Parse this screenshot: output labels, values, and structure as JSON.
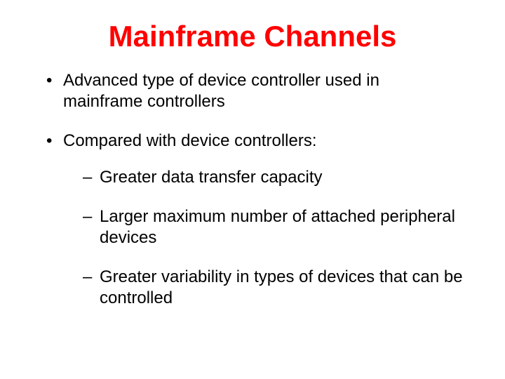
{
  "title": "Mainframe Channels",
  "bullets": [
    {
      "text": "Advanced type of device controller used in mainframe controllers"
    },
    {
      "text": "Compared with device controllers:",
      "sub": [
        "Greater data transfer capacity",
        "Larger maximum number of attached peripheral devices",
        "Greater variability in types of devices that can be controlled"
      ]
    }
  ]
}
